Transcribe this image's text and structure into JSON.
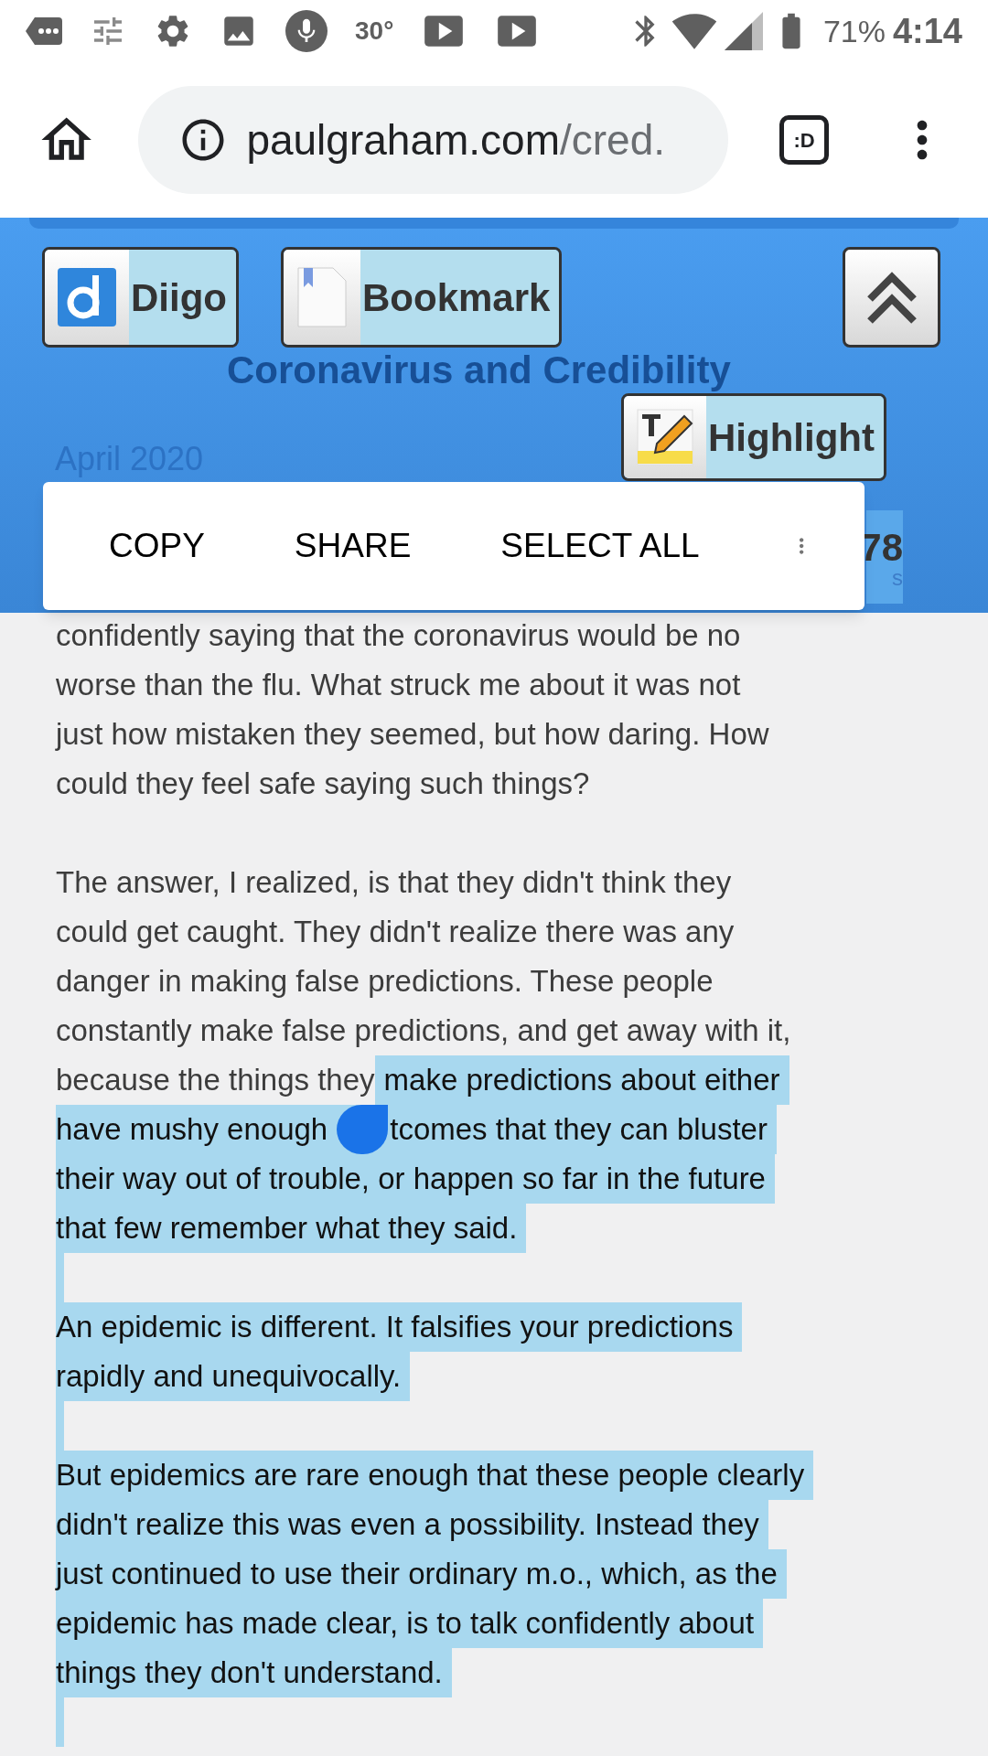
{
  "status_bar": {
    "temperature": "30°",
    "battery": "71%",
    "time": "4:14"
  },
  "browser": {
    "url_domain": "paulgraham.com",
    "url_path": "/cred.",
    "tab_count": ":D"
  },
  "diigo_toolbar": {
    "buttons": [
      {
        "label": "Diigo",
        "kind": "diigo"
      },
      {
        "label": "Bookmark",
        "kind": "bookmark"
      },
      {
        "label": "Highlight",
        "kind": "highlight"
      }
    ]
  },
  "article": {
    "title": "Coronavirus and Credibility",
    "date": "April 2020",
    "counter": "78",
    "counter_caption": "s",
    "lines": [
      {
        "segments": [
          {
            "text": "confidently saying that the coronavirus would be no",
            "selected": false
          }
        ]
      },
      {
        "segments": [
          {
            "text": "worse than the flu. What struck me about it was not",
            "selected": false
          }
        ]
      },
      {
        "segments": [
          {
            "text": "just how mistaken they seemed, but how daring. How",
            "selected": false
          }
        ]
      },
      {
        "segments": [
          {
            "text": "could they feel safe saying such things?",
            "selected": false
          }
        ]
      },
      {
        "kind": "blank",
        "selected": false
      },
      {
        "segments": [
          {
            "text": "The answer, I realized, is that they didn't think they",
            "selected": false
          }
        ]
      },
      {
        "segments": [
          {
            "text": "could get caught. They didn't realize there was any",
            "selected": false
          }
        ]
      },
      {
        "segments": [
          {
            "text": "danger in making false predictions. These people",
            "selected": false
          }
        ]
      },
      {
        "segments": [
          {
            "text": "constantly make false predictions, and get away with it,",
            "selected": false
          }
        ]
      },
      {
        "segments": [
          {
            "text": "because the things they",
            "selected": false
          },
          {
            "text": "make predictions about either",
            "selected": true
          }
        ]
      },
      {
        "segments": [
          {
            "text": "have mushy enough",
            "selected": true
          },
          {
            "kind": "handle"
          },
          {
            "text": "tcomes that they can bluster",
            "selected": true
          }
        ]
      },
      {
        "segments": [
          {
            "text": "their way out of trouble, or happen so far in the future",
            "selected": true
          }
        ]
      },
      {
        "segments": [
          {
            "text": "that few remember what they said.",
            "selected": true
          }
        ]
      },
      {
        "kind": "blank",
        "selected": true
      },
      {
        "segments": [
          {
            "text": "An epidemic is different. It falsifies your predictions",
            "selected": true
          }
        ]
      },
      {
        "segments": [
          {
            "text": "rapidly and unequivocally.",
            "selected": true
          }
        ]
      },
      {
        "kind": "blank",
        "selected": true
      },
      {
        "segments": [
          {
            "text": "But epidemics are rare enough that these people clearly",
            "selected": true
          }
        ]
      },
      {
        "segments": [
          {
            "text": "didn't realize this was even a possibility. Instead they",
            "selected": true
          }
        ]
      },
      {
        "segments": [
          {
            "text": "just continued to use their ordinary m.o., which, as the",
            "selected": true
          }
        ]
      },
      {
        "segments": [
          {
            "text": "epidemic has made clear, is to talk confidently about",
            "selected": true
          }
        ]
      },
      {
        "segments": [
          {
            "text": "things they don't understand.",
            "selected": true
          }
        ]
      },
      {
        "kind": "blank",
        "selected": true
      }
    ]
  },
  "selection_menu": {
    "items": [
      "COPY",
      "SHARE",
      "SELECT ALL"
    ]
  }
}
